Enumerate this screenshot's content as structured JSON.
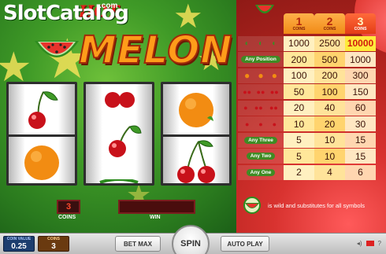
{
  "watermark": {
    "slot": "Slot",
    "catalog": "Catalog",
    "com": ".com"
  },
  "title": {
    "hot": "HOT",
    "melon": "MELON"
  },
  "paytable": {
    "headers": [
      {
        "number": "1",
        "label": "COINS"
      },
      {
        "number": "2",
        "label": "COINS"
      },
      {
        "number": "3",
        "label": "COINS"
      }
    ],
    "rows": [
      {
        "symbol": "melon-triple",
        "label": "",
        "values": [
          "1000",
          "2500",
          "10000"
        ]
      },
      {
        "symbol": "any-position",
        "label": "Any Position",
        "values": [
          "200",
          "500",
          "1000"
        ]
      },
      {
        "symbol": "orange-triple",
        "label": "",
        "values": [
          "100",
          "200",
          "300"
        ]
      },
      {
        "symbol": "cherry-double-triple",
        "label": "",
        "values": [
          "50",
          "100",
          "150"
        ]
      },
      {
        "symbol": "cherry-double-mix",
        "label": "",
        "values": [
          "20",
          "40",
          "60"
        ]
      },
      {
        "symbol": "cherry-triple",
        "label": "",
        "values": [
          "10",
          "20",
          "30"
        ]
      },
      {
        "symbol": "any-three",
        "label": "Any Three",
        "values": [
          "5",
          "10",
          "15"
        ]
      },
      {
        "symbol": "any-two",
        "label": "Any Two",
        "values": [
          "5",
          "10",
          "15"
        ]
      },
      {
        "symbol": "any-one",
        "label": "Any One",
        "values": [
          "2",
          "4",
          "6"
        ]
      }
    ],
    "wild_note": "is wild and substitutes for all symbols"
  },
  "reels": [
    {
      "top": "cherry",
      "bottom": "orange"
    },
    {
      "top": "cherry-partial",
      "bottom": "cherry"
    },
    {
      "top": "orange",
      "bottom": "double-cherry"
    }
  ],
  "coins_display": {
    "value": "3",
    "label": "COINS"
  },
  "win_display": {
    "value": "",
    "label": "WIN"
  },
  "controls": {
    "coin_value_label": "COIN VALUE",
    "coin_value": "0.25",
    "coins_label": "COINS",
    "coins_value": "3",
    "bet_max": "BET MAX",
    "spin": "SPIN",
    "auto_play": "AUTO PLAY",
    "help": "?"
  },
  "colors": {
    "green_bg": "#3f9a27",
    "red_panel": "#b72520",
    "title_orange": "#ff9c1a",
    "highlight_value": "#d11b0f"
  }
}
